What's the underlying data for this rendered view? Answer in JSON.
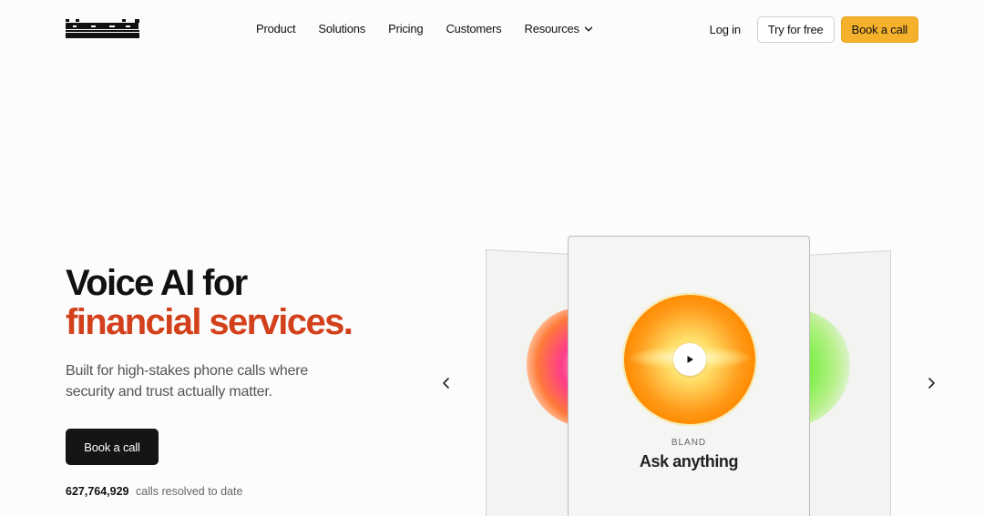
{
  "brand": {
    "logo_text": "bland",
    "logo_icon": "bland-wordmark-logo"
  },
  "nav": {
    "items": [
      "Product",
      "Solutions",
      "Pricing",
      "Customers"
    ],
    "resources_label": "Resources",
    "resources_icon": "chevron-down-icon",
    "login_label": "Log in",
    "try_label": "Try for free",
    "book_label": "Book a call"
  },
  "hero": {
    "title_line1": "Voice AI for",
    "title_line2": "financial services.",
    "subtitle": "Built for high-stakes phone calls where security and trust actually matter.",
    "cta_label": "Book a call",
    "stat_number": "627,764,929",
    "stat_text": "calls resolved to date"
  },
  "carousel": {
    "prev_icon": "chevron-left-icon",
    "next_icon": "chevron-right-icon",
    "play_icon": "play-icon",
    "card_brand": "BLAND",
    "card_title": "Ask anything"
  },
  "colors": {
    "accent": "#f5b12c",
    "title_accent": "#d2411c",
    "cta_bg": "#151515",
    "background": "#fcfcfc"
  }
}
